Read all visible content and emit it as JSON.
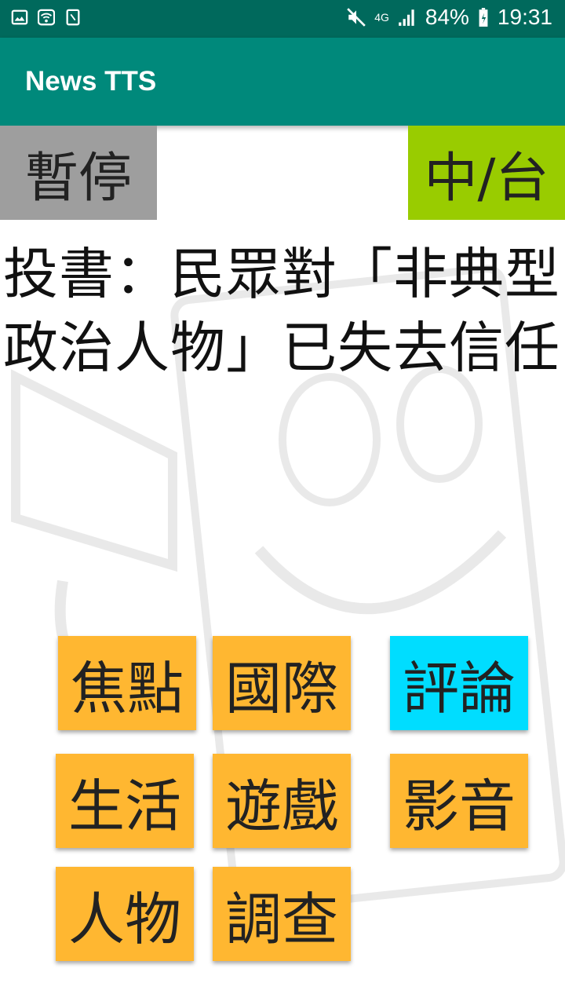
{
  "status_bar": {
    "battery": "84%",
    "time": "19:31",
    "network": "4G",
    "icons": [
      "gallery-icon",
      "wifi-icon",
      "sim-icon",
      "mute-icon",
      "signal-icon",
      "battery-icon"
    ]
  },
  "app_bar": {
    "title": "News TTS"
  },
  "controls": {
    "pause_label": "暫停",
    "lang_label": "中/台"
  },
  "headline": "投書：民眾對「非典型政治人物」已失去信任",
  "categories": [
    {
      "label": "焦點",
      "active": false
    },
    {
      "label": "國際",
      "active": false
    },
    {
      "label": "評論",
      "active": true
    },
    {
      "label": "生活",
      "active": false
    },
    {
      "label": "遊戲",
      "active": false
    },
    {
      "label": "影音",
      "active": false
    },
    {
      "label": "人物",
      "active": false
    },
    {
      "label": "調查",
      "active": false
    }
  ],
  "colors": {
    "status_bar": "#00695c",
    "app_bar": "#00897b",
    "pause_button": "#9e9e9e",
    "lang_button": "#99cc00",
    "category_button": "#ffb731",
    "category_active": "#00ddff"
  }
}
